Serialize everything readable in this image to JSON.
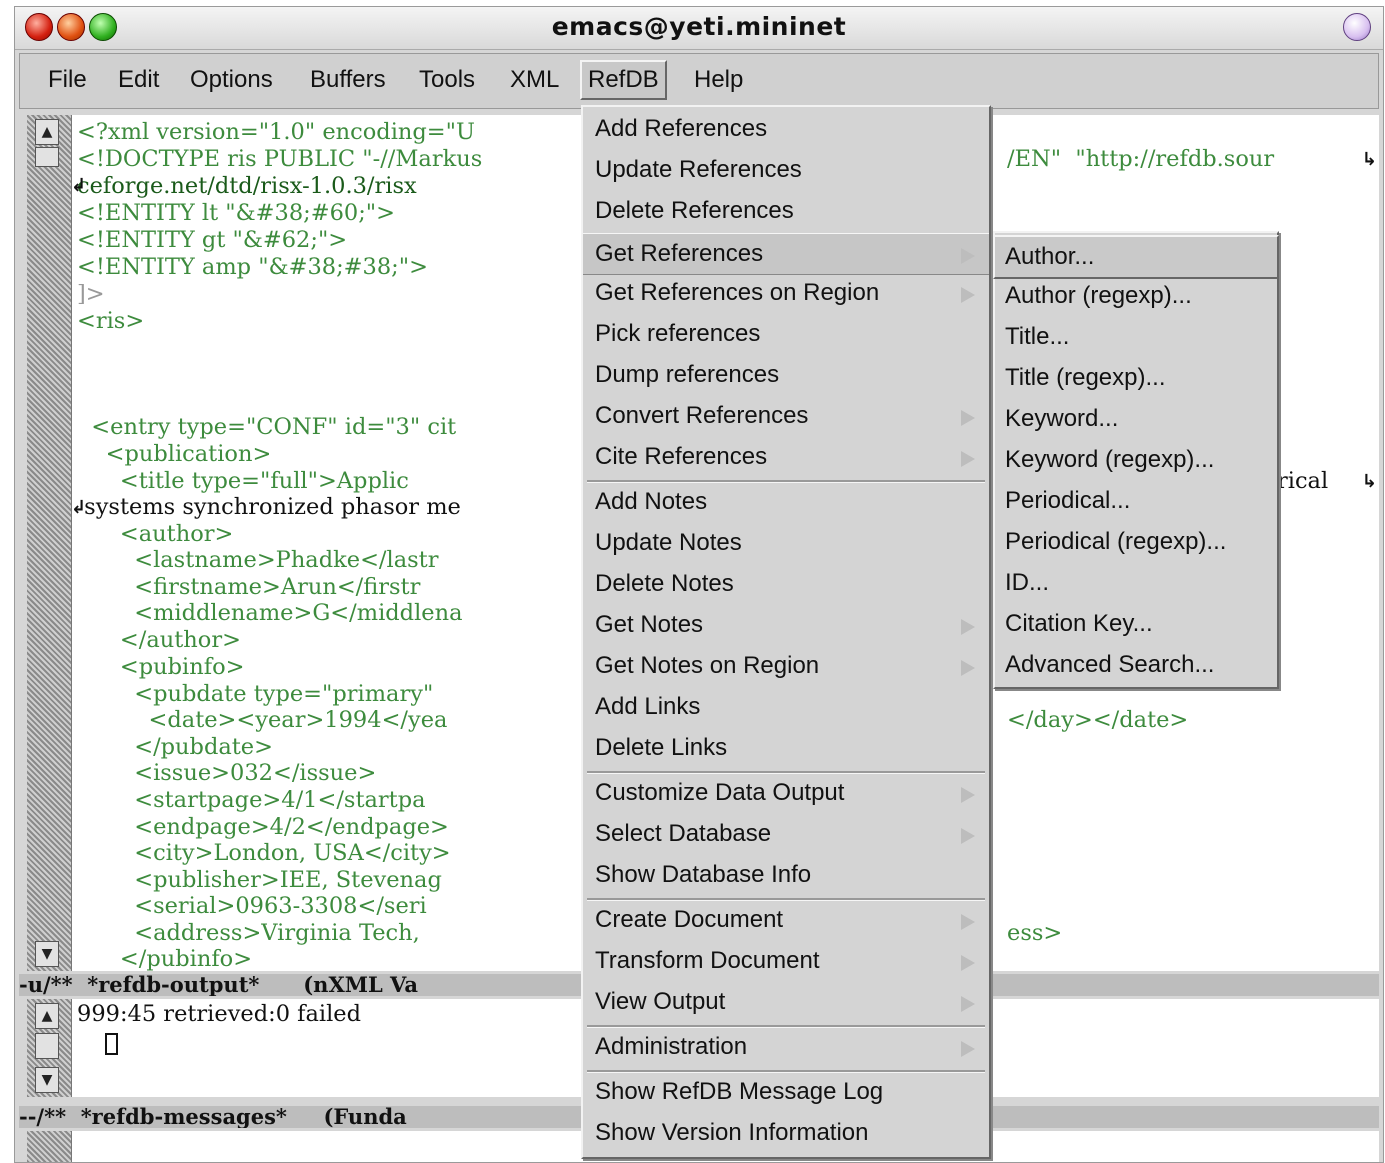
{
  "window": {
    "title": "emacs@yeti.mininet"
  },
  "menubar": {
    "items": [
      "File",
      "Edit",
      "Options",
      "Buffers",
      "Tools",
      "XML",
      "RefDB",
      "Help"
    ],
    "active": "RefDB"
  },
  "editor": {
    "lines": [
      "<?xml version=\"1.0\" encoding=\"U",
      "<!DOCTYPE ris PUBLIC \"-//Markus",
      "ceforge.net/dtd/risx-1.0.3/risx",
      "<!ENTITY lt \"&#38;#60;\">",
      "<!ENTITY gt \"&#62;\">",
      "<!ENTITY amp \"&#38;#38;\">",
      "]>",
      "<ris>",
      "",
      "",
      "",
      "  <entry type=\"CONF\" id=\"3\" cit",
      "    <publication>",
      "      <title type=\"full\">Applic",
      " systems synchronized phasor me",
      "      <author>",
      "        <lastname>Phadke</lastr",
      "        <firstname>Arun</firstr",
      "        <middlename>G</middlena",
      "      </author>",
      "      <pubinfo>",
      "        <pubdate type=\"primary\"",
      "          <date><year>1994</yea",
      "        </pubdate>",
      "        <issue>032</issue>",
      "        <startpage>4/1</startpa",
      "        <endpage>4/2</endpage>",
      "        <city>London, USA</city>",
      "        <publisher>IEE, Stevenag",
      "        <serial>0963-3308</seri",
      "        <address>Virginia Tech,",
      "      </pubinfo>"
    ],
    "right_fragments": {
      "line1": "/EN\"  \"http://refdb.sour",
      "line13": "rical",
      "line22": "</day></date>",
      "line30": "ess>"
    }
  },
  "modeline1": "-u/**  *refdb-output*      (nXML Va",
  "output": {
    "line": "999:45 retrieved:0 failed"
  },
  "modeline2": "--/**  *refdb-messages*     (Funda",
  "refdb_menu": {
    "items": [
      {
        "label": "Add References"
      },
      {
        "label": "Update References"
      },
      {
        "label": "Delete References"
      },
      {
        "label": "Get References",
        "submenu": true,
        "highlighted": true
      },
      {
        "label": "Get References on Region",
        "submenu": true
      },
      {
        "label": "Pick references"
      },
      {
        "label": "Dump references"
      },
      {
        "label": "Convert References",
        "submenu": true
      },
      {
        "label": "Cite References",
        "submenu": true
      },
      {
        "label": "Add Notes"
      },
      {
        "label": "Update Notes"
      },
      {
        "label": "Delete Notes"
      },
      {
        "label": "Get Notes",
        "submenu": true
      },
      {
        "label": "Get Notes on Region",
        "submenu": true
      },
      {
        "label": "Add Links"
      },
      {
        "label": "Delete Links"
      },
      {
        "label": "Customize Data Output",
        "submenu": true
      },
      {
        "label": "Select Database",
        "submenu": true
      },
      {
        "label": "Show Database Info"
      },
      {
        "label": "Create Document",
        "submenu": true
      },
      {
        "label": "Transform Document",
        "submenu": true
      },
      {
        "label": "View Output",
        "submenu": true
      },
      {
        "label": "Administration",
        "submenu": true
      },
      {
        "label": "Show RefDB Message Log"
      },
      {
        "label": "Show Version Information"
      }
    ]
  },
  "get_references_submenu": {
    "items": [
      {
        "label": "Author...",
        "highlighted": true
      },
      {
        "label": "Author (regexp)..."
      },
      {
        "label": "Title..."
      },
      {
        "label": "Title (regexp)..."
      },
      {
        "label": "Keyword..."
      },
      {
        "label": "Keyword (regexp)..."
      },
      {
        "label": "Periodical..."
      },
      {
        "label": "Periodical (regexp)..."
      },
      {
        "label": "ID..."
      },
      {
        "label": "Citation Key..."
      },
      {
        "label": "Advanced Search..."
      }
    ]
  }
}
